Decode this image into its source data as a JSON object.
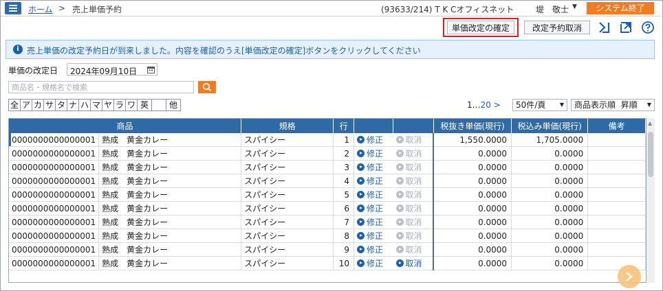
{
  "header": {
    "home": "ホーム",
    "separator": ">",
    "page": "売上単価予約",
    "user_info": "(93633/214) T K Cオフィスネット",
    "user_name": "堤　敬士",
    "user_caret": "▼",
    "exit_label": "システム終了"
  },
  "toolbar": {
    "confirm_label": "単価改定の確定",
    "cancel_label": "改定予約取消"
  },
  "notice": {
    "icon": "i",
    "text": "売上単価の改定予約日が到来しました。内容を確認のうえ[単価改定の確定]ボタンをクリックしてください"
  },
  "form": {
    "date_label": "単価の改定日",
    "date_value": "2024年09月10日",
    "search_placeholder": "商品名・規格名で検索"
  },
  "kana_filter": [
    "全",
    "ア",
    "カ",
    "サ",
    "タ",
    "ナ",
    "ハ",
    "マ",
    "ヤ",
    "ラ",
    "ワ",
    "英",
    "",
    "他"
  ],
  "pager": {
    "first": "1",
    "ellipsis": "…",
    "last": "20",
    "next": ">",
    "per_page": "50件/頁",
    "sort_label": "商品表示順",
    "sort_order": "昇順"
  },
  "table": {
    "headers": [
      "商品",
      "規格",
      "行",
      "",
      "",
      "税抜き単価(現行)",
      "税込み単価(現行)",
      "備考"
    ],
    "action_edit": "修正",
    "action_cancel": "取消",
    "rows": [
      {
        "code": "0000000000000001",
        "name": "熟成　黄金カレー",
        "spec": "スパイシー",
        "line": "1",
        "ex": "1,550.0000",
        "in": "1,705.0000",
        "cancel_active": false
      },
      {
        "code": "0000000000000001",
        "name": "熟成　黄金カレー",
        "spec": "スパイシー",
        "line": "2",
        "ex": "0.0000",
        "in": "0.0000",
        "cancel_active": false
      },
      {
        "code": "0000000000000001",
        "name": "熟成　黄金カレー",
        "spec": "スパイシー",
        "line": "3",
        "ex": "0.0000",
        "in": "0.0000",
        "cancel_active": false
      },
      {
        "code": "0000000000000001",
        "name": "熟成　黄金カレー",
        "spec": "スパイシー",
        "line": "4",
        "ex": "0.0000",
        "in": "0.0000",
        "cancel_active": false
      },
      {
        "code": "0000000000000001",
        "name": "熟成　黄金カレー",
        "spec": "スパイシー",
        "line": "5",
        "ex": "0.0000",
        "in": "0.0000",
        "cancel_active": false
      },
      {
        "code": "0000000000000001",
        "name": "熟成　黄金カレー",
        "spec": "スパイシー",
        "line": "6",
        "ex": "0.0000",
        "in": "0.0000",
        "cancel_active": false
      },
      {
        "code": "0000000000000001",
        "name": "熟成　黄金カレー",
        "spec": "スパイシー",
        "line": "7",
        "ex": "0.0000",
        "in": "0.0000",
        "cancel_active": false
      },
      {
        "code": "0000000000000001",
        "name": "熟成　黄金カレー",
        "spec": "スパイシー",
        "line": "8",
        "ex": "0.0000",
        "in": "0.0000",
        "cancel_active": false
      },
      {
        "code": "0000000000000001",
        "name": "熟成　黄金カレー",
        "spec": "スパイシー",
        "line": "9",
        "ex": "0.0000",
        "in": "0.0000",
        "cancel_active": false
      },
      {
        "code": "0000000000000001",
        "name": "熟成　黄金カレー",
        "spec": "スパイシー",
        "line": "10",
        "ex": "0.0000",
        "in": "0.0000",
        "cancel_active": true
      }
    ]
  },
  "colors": {
    "accent": "#2e6aa6",
    "brand_orange": "#f47b20",
    "link": "#1a5fb4",
    "alert": "#e01b24"
  }
}
